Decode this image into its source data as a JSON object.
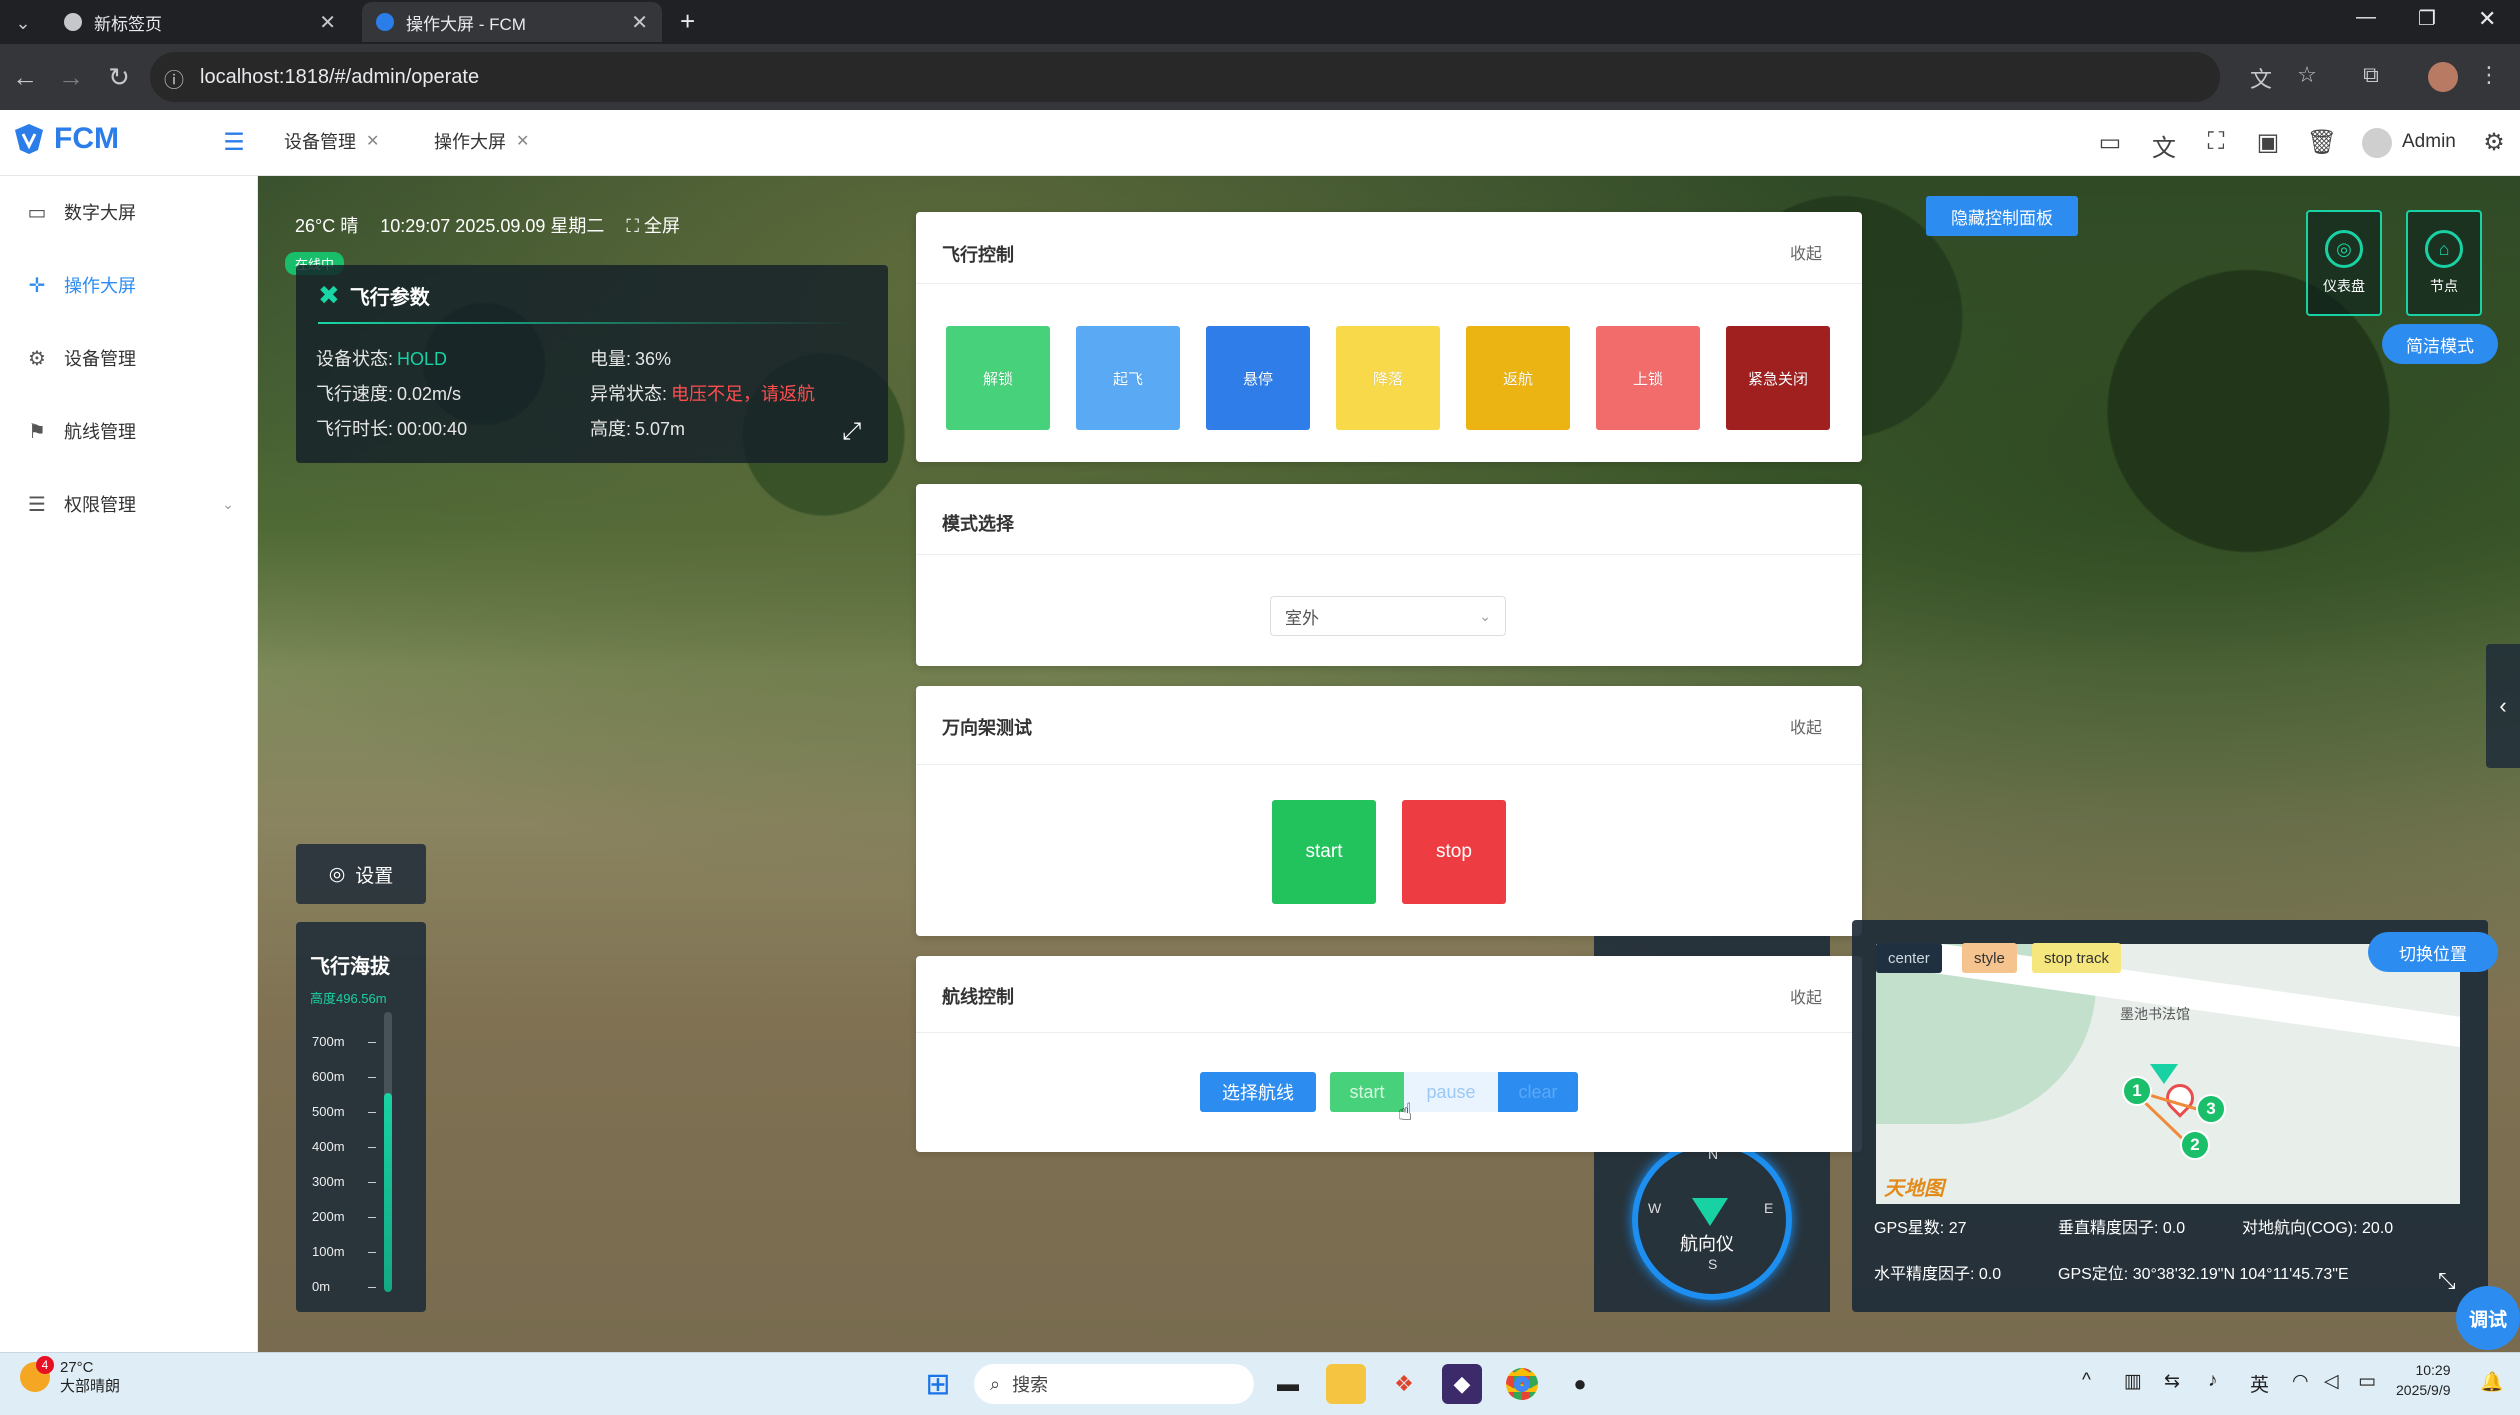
{
  "browser": {
    "tabs": [
      {
        "title": "新标签页",
        "active": false
      },
      {
        "title": "操作大屏 - FCM",
        "active": true
      }
    ],
    "new_tab": "+",
    "url": "localhost:1818/#/admin/operate"
  },
  "app": {
    "logo": "FCM",
    "tabs": [
      {
        "label": "设备管理"
      },
      {
        "label": "操作大屏"
      }
    ],
    "user": "Admin"
  },
  "sidebar": {
    "items": [
      {
        "label": "数字大屏",
        "icon": "monitor-icon"
      },
      {
        "label": "操作大屏",
        "icon": "crosshair-icon",
        "active": true
      },
      {
        "label": "设备管理",
        "icon": "gear-icon"
      },
      {
        "label": "航线管理",
        "icon": "flag-icon"
      },
      {
        "label": "权限管理",
        "icon": "sliders-icon"
      }
    ]
  },
  "weather": {
    "temp": "26°C 晴",
    "datetime": "10:29:07 2025.09.09 星期二",
    "fullscreen": "全屏"
  },
  "status_badge": "在线中",
  "flight_params": {
    "title": "飞行参数",
    "device_status_label": "设备状态:",
    "device_status": "HOLD",
    "battery_label": "电量:",
    "battery": "36%",
    "speed_label": "飞行速度:",
    "speed": "0.02m/s",
    "abnormal_label": "异常状态:",
    "abnormal": "电压不足，请返航",
    "duration_label": "飞行时长:",
    "duration": "00:00:40",
    "height_label": "高度:",
    "height": "5.07m"
  },
  "settings": {
    "label": "设置"
  },
  "altitude": {
    "title": "飞行海拔",
    "sub": "高度496.56m",
    "ticks": [
      "700m",
      "600m",
      "500m",
      "400m",
      "300m",
      "200m",
      "100m",
      "0m"
    ],
    "level_fraction": 0.71
  },
  "flight_control": {
    "title": "飞行控制",
    "collapse": "收起",
    "buttons": [
      {
        "label": "解锁",
        "color": "#47d17a"
      },
      {
        "label": "起飞",
        "color": "#5aa9f5"
      },
      {
        "label": "悬停",
        "color": "#2f7de8"
      },
      {
        "label": "降落",
        "color": "#f8d94a"
      },
      {
        "label": "返航",
        "color": "#ecb412"
      },
      {
        "label": "上锁",
        "color": "#f26c6c"
      },
      {
        "label": "紧急关闭",
        "color": "#a01f1f"
      }
    ]
  },
  "mode_select": {
    "title": "模式选择",
    "value": "室外"
  },
  "gimbal": {
    "title": "万向架测试",
    "collapse": "收起",
    "start": "start",
    "stop": "stop"
  },
  "route_control": {
    "title": "航线控制",
    "collapse": "收起",
    "select_route": "选择航线",
    "start": "start",
    "pause": "pause",
    "clear": "clear"
  },
  "compass": {
    "label": "航向仪",
    "n": "N",
    "s": "S",
    "e": "E",
    "w": "W"
  },
  "map": {
    "buttons": {
      "center": "center",
      "style": "style",
      "stop_track": "stop track"
    },
    "poi": "墨池书法馆",
    "logo": "天地图",
    "waypoints": [
      "1",
      "2",
      "3"
    ]
  },
  "gps": {
    "sats_label": "GPS星数:",
    "sats": "27",
    "vdop_label": "垂直精度因子:",
    "vdop": "0.0",
    "cog_label": "对地航向(COG):",
    "cog": "20.0",
    "hdop_label": "水平精度因子:",
    "hdop": "0.0",
    "pos_label": "GPS定位:",
    "pos": "30°38'32.19\"N   104°11'45.73\"E"
  },
  "switch_position": "切换位置",
  "hide_panel": "隐藏控制面板",
  "nodes": [
    {
      "label": "仪表盘"
    },
    {
      "label": "节点"
    }
  ],
  "simple_mode": "简洁模式",
  "debug": "调试",
  "taskbar": {
    "weather_temp": "27°C",
    "weather_desc": "大部晴朗",
    "notif_count": "4",
    "search": "搜索",
    "time": "10:29",
    "date": "2025/9/9",
    "lang": "英"
  }
}
